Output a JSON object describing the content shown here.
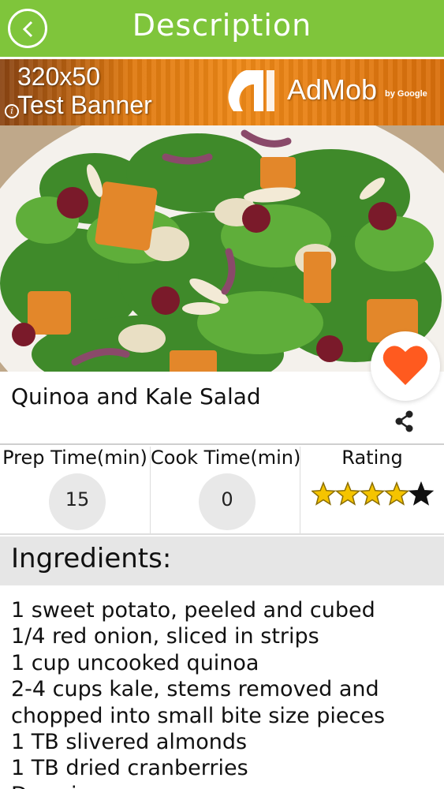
{
  "header": {
    "title": "Description",
    "back_icon": "chevron-left-icon"
  },
  "ad": {
    "line1": "320x50",
    "line2": "Test Banner",
    "brand": "AdMob",
    "brand_by": "by Google",
    "info_icon": "info-icon"
  },
  "recipe": {
    "title": "Quinoa and Kale Salad",
    "favorite_icon": "heart-icon",
    "share_icon": "share-icon"
  },
  "stats": {
    "prep_label": "Prep Time(min)",
    "prep_value": "15",
    "cook_label": "Cook Time(min)",
    "cook_value": "0",
    "rating_label": "Rating",
    "rating_value": 4,
    "rating_max": 5
  },
  "ingredients": {
    "heading": "Ingredients:",
    "items": [
      "1 sweet potato, peeled and cubed",
      "1/4 red onion, sliced in strips",
      "1 cup uncooked quinoa",
      "2-4 cups kale, stems removed and",
      "chopped into small bite size pieces",
      "1 TB slivered almonds",
      "1 TB dried cranberries",
      "Dressing:"
    ]
  },
  "colors": {
    "header_bg": "#7fc53b",
    "heart": "#ff5a1f",
    "star_filled": "#f5c400",
    "star_empty": "#111111"
  }
}
